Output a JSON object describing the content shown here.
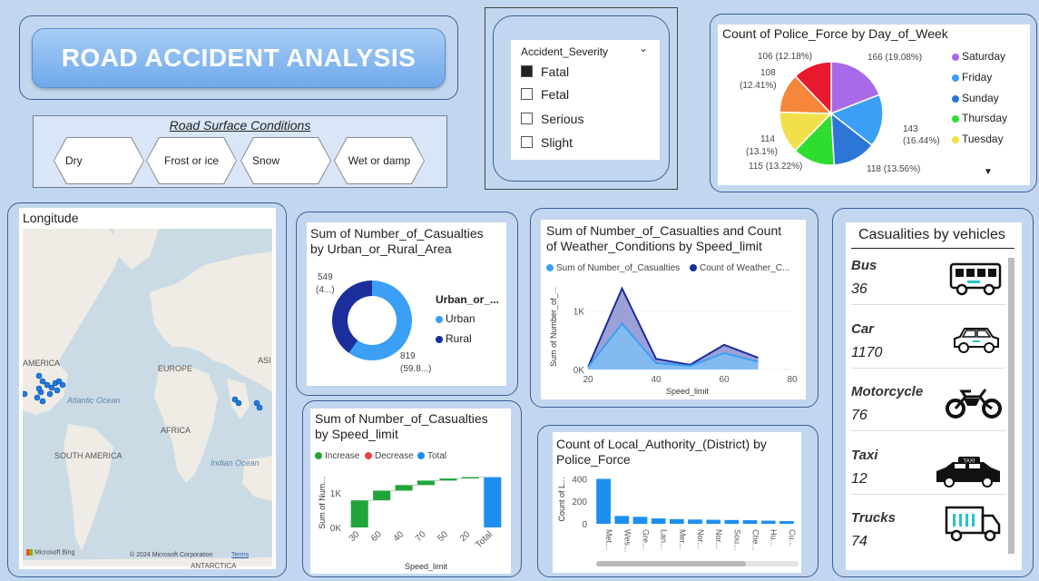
{
  "title": "ROAD ACCIDENT ANALYSIS",
  "road_surface": {
    "title": "Road Surface Conditions",
    "options": [
      "Dry",
      "Frost or ice",
      "Snow",
      "Wet or damp"
    ]
  },
  "severity": {
    "title": "Accident_Severity",
    "options": [
      {
        "label": "Fatal",
        "checked": true
      },
      {
        "label": "Fetal",
        "checked": false
      },
      {
        "label": "Serious",
        "checked": false
      },
      {
        "label": "Slight",
        "checked": false
      }
    ]
  },
  "police_pie": {
    "title": "Count of Police_Force by Day_of_Week",
    "slice_labels": [
      "166 (19.08%)",
      "143",
      "(16.44%)",
      "118 (13.56%)",
      "115 (13.22%)",
      "114",
      "(13.1%)",
      "108",
      "(12.41%)",
      "106 (12.18%)"
    ],
    "legend": [
      "Saturday",
      "Friday",
      "Sunday",
      "Thursday",
      "Tuesday"
    ],
    "colors": [
      "#a86ae8",
      "#3a9ff5",
      "#2d75d6",
      "#2fdd2f",
      "#f2e04a",
      "#f5863a",
      "#e8192c"
    ]
  },
  "map": {
    "title": "Longitude",
    "labels": [
      "AMERICA",
      "EUROPE",
      "ASI",
      "Atlantic Ocean",
      "AFRICA",
      "SOUTH AMERICA",
      "Indian Ocean"
    ],
    "bing": "Microsoft Bing",
    "copyright": "© 2024 Microsoft Corporation",
    "terms": "Terms",
    "bottom_label": "ANTARCTICA"
  },
  "donut": {
    "title_line1": "Sum of Number_of_Casualties",
    "title_line2": "by Urban_or_Rural_Area",
    "legend_title": "Urban_or_...",
    "label_rural_1": "549",
    "label_rural_2": "(4...)",
    "label_urban_1": "819",
    "label_urban_2": "(59.8...)",
    "legend": [
      "Urban",
      "Rural"
    ]
  },
  "line_chart": {
    "title_line1": "Sum of Number_of_Casualties and Count",
    "title_line2": "of Weather_Conditions by Speed_limit",
    "legend": [
      "Sum of Number_of_Casualties",
      "Count of Weather_C..."
    ],
    "ylabel": "Sum of Number_of_...",
    "xlabel": "Speed_limit"
  },
  "waterfall": {
    "title_line1": "Sum of Number_of_Casualties",
    "title_line2": "by Speed_limit",
    "legend": [
      "Increase",
      "Decrease",
      "Total"
    ],
    "ylabel": "Sum of Num...",
    "xlabel": "Speed_limit"
  },
  "authority": {
    "title_line1": "Count of Local_Authority_(District) by",
    "title_line2": "Police_Force",
    "ylabel": "Count of L..."
  },
  "vehicles": {
    "title": "Casualities by vehicles",
    "items": [
      {
        "name": "Bus",
        "value": "36",
        "icon": "bus-icon"
      },
      {
        "name": "Car",
        "value": "1170",
        "icon": "car-icon"
      },
      {
        "name": "Motorcycle",
        "value": "76",
        "icon": "motorcycle-icon"
      },
      {
        "name": "Taxi",
        "value": "12",
        "icon": "taxi-icon"
      },
      {
        "name": "Trucks",
        "value": "74",
        "icon": "truck-icon"
      }
    ],
    "taxi_sign": "TAXI"
  },
  "chart_data": [
    {
      "type": "pie",
      "title": "Count of Police_Force by Day_of_Week",
      "categories": [
        "Saturday",
        "Friday",
        "Sunday",
        "Thursday",
        "Tuesday",
        "",
        ""
      ],
      "values": [
        166,
        143,
        118,
        115,
        114,
        108,
        106
      ],
      "legend": "right"
    },
    {
      "type": "pie",
      "title": "Sum of Number_of_Casualties by Urban_or_Rural_Area",
      "categories": [
        "Urban",
        "Rural"
      ],
      "values": [
        819,
        549
      ],
      "legend": "right"
    },
    {
      "type": "area",
      "title": "Sum of Number_of_Casualties and Count of Weather_Conditions by Speed_limit",
      "x": [
        20,
        30,
        40,
        50,
        60,
        70
      ],
      "series": [
        {
          "name": "Sum of Number_of_Casualties",
          "values": [
            40,
            780,
            110,
            60,
            280,
            130
          ]
        },
        {
          "name": "Count of Weather_C...",
          "values": [
            40,
            1380,
            180,
            80,
            420,
            200
          ]
        }
      ],
      "xlim": [
        20,
        80
      ],
      "ylim": [
        0,
        1500
      ],
      "x_ticks": [
        20,
        40,
        60,
        80
      ],
      "y_ticks": [
        "0K",
        "1K"
      ],
      "xlabel": "Speed_limit",
      "ylabel": "Sum of Number_of_..."
    },
    {
      "type": "bar",
      "title": "Sum of Number_of_Casualties by Speed_limit",
      "categories": [
        "30",
        "60",
        "40",
        "70",
        "50",
        "20",
        "Total"
      ],
      "values": [
        780,
        280,
        160,
        130,
        60,
        40,
        1450
      ],
      "kinds": [
        "increase",
        "increase",
        "increase",
        "increase",
        "increase",
        "increase",
        "total"
      ],
      "ylim": [
        0,
        1700
      ],
      "y_ticks": [
        "0K",
        "1K"
      ],
      "xlabel": "Speed_limit",
      "ylabel": "Sum of Num..."
    },
    {
      "type": "bar",
      "title": "Count of Local_Authority_(District) by Police_Force",
      "categories": [
        "Met...",
        "Wes...",
        "Gre...",
        "Lan...",
        "Mer...",
        "Nor...",
        "Nor...",
        "Sou...",
        "Che...",
        "Hu...",
        "Cu..."
      ],
      "values": [
        400,
        70,
        62,
        48,
        42,
        38,
        36,
        34,
        32,
        28,
        24
      ],
      "ylim": [
        0,
        420
      ],
      "y_ticks": [
        0,
        100,
        200,
        300,
        400
      ],
      "ylabel": "Count of L..."
    }
  ]
}
